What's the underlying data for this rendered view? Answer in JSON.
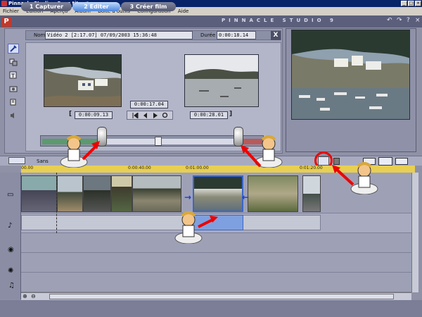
{
  "window": {
    "title": "Pinnacle Studio - Sans titre *",
    "min": "_",
    "max": "□",
    "close": "×"
  },
  "menu": [
    "Fichier",
    "Edition",
    "Aperçu",
    "Album",
    "Boîte à outils",
    "Configuration",
    "Aide"
  ],
  "modes": [
    {
      "label": "1 Capturer",
      "active": false
    },
    {
      "label": "2 Editer",
      "active": true
    },
    {
      "label": "3 Créer film",
      "active": false
    }
  ],
  "brand": "PINNACLE STUDIO 9",
  "clip_editor": {
    "name_label": "Nom",
    "name_value": "Vidéo 2 [2:17.07] 07/09/2003 15:36:48",
    "duration_label": "Durée",
    "duration_value": "0:00:18.14",
    "close_label": "X",
    "tc_in": "0:00:09.13",
    "tc_current": "0:00:17.04",
    "tc_out": "0:00:28.01",
    "bracket_open": "[",
    "bracket_close": "]"
  },
  "timeline": {
    "project_label": "Sans",
    "ruler_ticks": [
      "00.00",
      "0:00:40.00",
      "0:01:00.00",
      "0:01:20.00"
    ]
  },
  "colors": {
    "accent": "#4b86dd",
    "trim_left": "#5c9a6e",
    "trim_right": "#b85a5a",
    "ruler": "#e8cf52",
    "highlight": "#e00000"
  },
  "icons": {
    "tools": [
      "video-tools-icon",
      "transitions-icon",
      "titles-icon",
      "photos-icon",
      "audio-icon",
      "speaker-icon"
    ],
    "tracks": [
      "video-track-icon",
      "title-track-icon",
      "sound-effect-track-icon",
      "audio-track-icon",
      "music-track-icon"
    ]
  }
}
